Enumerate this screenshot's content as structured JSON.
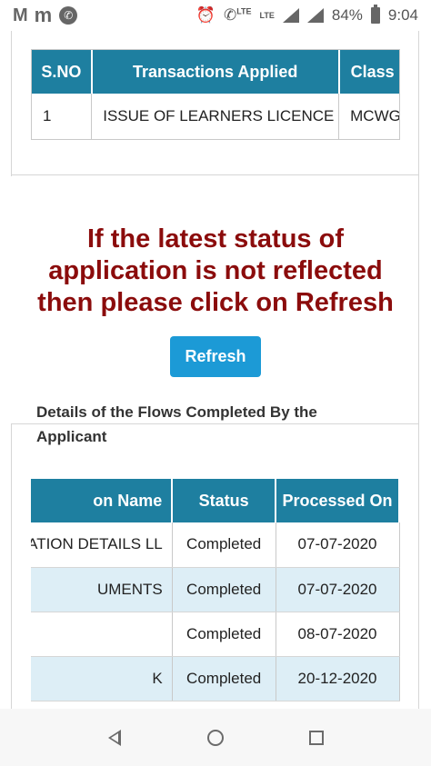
{
  "status_bar": {
    "left_icons": [
      "gmail-icon",
      "app-m-icon",
      "phone-icon"
    ],
    "lte1": "LTE",
    "lte2": "LTE",
    "battery": "84%",
    "time": "9:04"
  },
  "transactions_table": {
    "headers": [
      "S.NO",
      "Transactions Applied",
      "Class C"
    ],
    "rows": [
      [
        "1",
        "ISSUE OF LEARNERS LICENCE",
        "MCWG"
      ]
    ]
  },
  "message": "If the latest status of application is not reflected then please click on Refresh",
  "refresh_label": "Refresh",
  "flows_title": "Details of the Flows Completed By the Applicant",
  "flows_table": {
    "headers": [
      "on Name",
      "Status",
      "Processed On"
    ],
    "rows": [
      [
        "ATION DETAILS LL",
        "Completed",
        "07-07-2020"
      ],
      [
        "UMENTS",
        "Completed",
        "07-07-2020"
      ],
      [
        "",
        "Completed",
        "08-07-2020"
      ],
      [
        "K",
        "Completed",
        "20-12-2020"
      ]
    ]
  },
  "colors": {
    "header_bg": "#1e7fa0",
    "message_text": "#8b0c0c",
    "button_bg": "#1c9ad6",
    "alt_row_bg": "#ddeef6"
  }
}
